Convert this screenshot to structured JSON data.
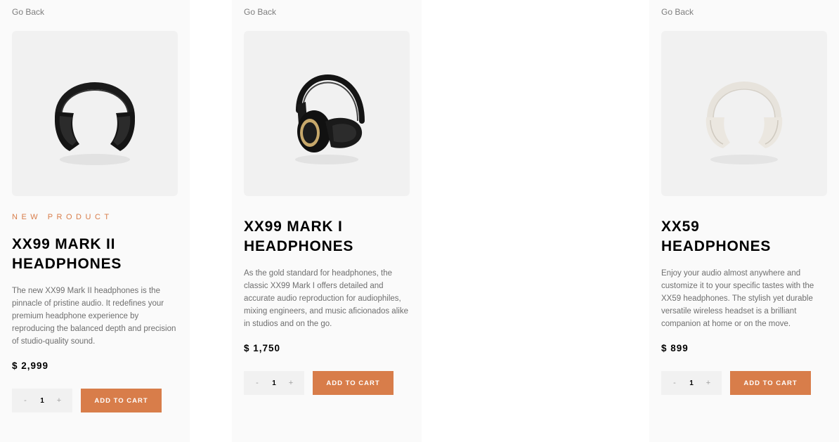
{
  "products": [
    {
      "go_back": "Go Back",
      "overline": "NEW PRODUCT",
      "title_line1": "XX99 MARK II",
      "title_line2": "HEADPHONES",
      "description": "The new XX99 Mark II headphones is the pinnacle of pristine audio. It redefines your premium headphone experience by reproducing the balanced depth and precision of studio-quality sound.",
      "price": "$ 2,999",
      "qty_minus": "-",
      "qty_value": "1",
      "qty_plus": "+",
      "add_label": "ADD TO CART"
    },
    {
      "go_back": "Go Back",
      "title_line1": "XX99 MARK I",
      "title_line2": "HEADPHONES",
      "description": "As the gold standard for headphones, the classic XX99 Mark I offers detailed and accurate audio reproduction for audiophiles, mixing engineers, and music aficionados alike in studios and on the go.",
      "price": "$ 1,750",
      "qty_minus": "-",
      "qty_value": "1",
      "qty_plus": "+",
      "add_label": "ADD TO CART"
    },
    {
      "go_back": "Go Back",
      "title_line1": "XX59",
      "title_line2": "HEADPHONES",
      "description": "Enjoy your audio almost anywhere and customize it to your specific tastes with the XX59 headphones. The stylish yet durable versatile wireless headset is a brilliant companion at home or on the move.",
      "price": "$ 899",
      "qty_minus": "-",
      "qty_value": "1",
      "qty_plus": "+",
      "add_label": "ADD TO CART"
    }
  ],
  "colors": {
    "accent": "#d87d4a",
    "card_bg": "#fafafa",
    "image_bg": "#f1f1f1"
  }
}
